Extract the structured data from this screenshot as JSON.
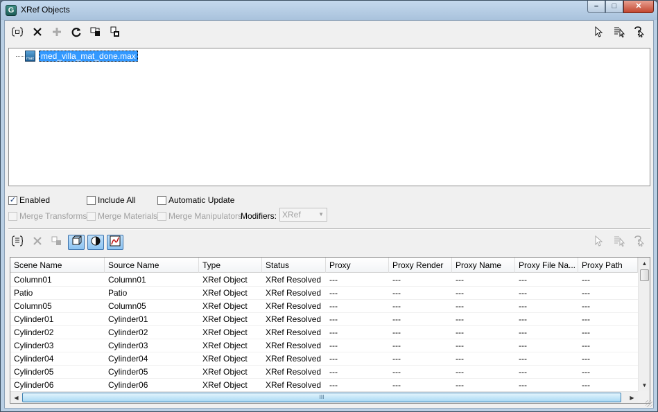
{
  "window": {
    "title": "XRef Objects",
    "app_icon_letter": "G"
  },
  "window_buttons": {
    "minimize": "–",
    "maximize": "□",
    "close": "✕"
  },
  "top_toolbar": {
    "left_icons": [
      "create-xref-icon",
      "remove-icon",
      "add-icon",
      "refresh-icon",
      "convert-selected-icon",
      "merge-icon"
    ],
    "right_icons": [
      "select-icon",
      "select-by-name-icon",
      "highlight-selected-icon"
    ]
  },
  "tree": {
    "file_name": "med_villa_mat_done.max",
    "file_icon_text": "max"
  },
  "options": {
    "enabled": {
      "label": "Enabled",
      "checked": true
    },
    "include_all": {
      "label": "Include All",
      "checked": false
    },
    "automatic_update": {
      "label": "Automatic Update",
      "checked": false
    },
    "merge_transforms": {
      "label": "Merge Transforms",
      "checked": false
    },
    "merge_materials": {
      "label": "Merge Materials",
      "checked": false
    },
    "merge_manipulators": {
      "label": "Merge Manipulators",
      "checked": false
    },
    "modifiers_label": "Modifiers:",
    "modifiers_value": "XRef"
  },
  "bottom_toolbar": {
    "left_icons": [
      "add-objects-icon",
      "remove-icon",
      "merge-in-scene-icon",
      "list-objects-icon",
      "list-materials-icon",
      "list-controllers-icon"
    ],
    "right_icons": [
      "select-icon",
      "select-by-name-icon",
      "highlight-selected-icon"
    ]
  },
  "table": {
    "columns": [
      "Scene Name",
      "Source Name",
      "Type",
      "Status",
      "Proxy",
      "Proxy Render",
      "Proxy Name",
      "Proxy File Na...",
      "Proxy Path"
    ],
    "rows": [
      [
        "Column01",
        "Column01",
        "XRef Object",
        "XRef Resolved",
        "---",
        "---",
        "---",
        "---",
        "---"
      ],
      [
        "Patio",
        "Patio",
        "XRef Object",
        "XRef Resolved",
        "---",
        "---",
        "---",
        "---",
        "---"
      ],
      [
        "Column05",
        "Column05",
        "XRef Object",
        "XRef Resolved",
        "---",
        "---",
        "---",
        "---",
        "---"
      ],
      [
        "Cylinder01",
        "Cylinder01",
        "XRef Object",
        "XRef Resolved",
        "---",
        "---",
        "---",
        "---",
        "---"
      ],
      [
        "Cylinder02",
        "Cylinder02",
        "XRef Object",
        "XRef Resolved",
        "---",
        "---",
        "---",
        "---",
        "---"
      ],
      [
        "Cylinder03",
        "Cylinder03",
        "XRef Object",
        "XRef Resolved",
        "---",
        "---",
        "---",
        "---",
        "---"
      ],
      [
        "Cylinder04",
        "Cylinder04",
        "XRef Object",
        "XRef Resolved",
        "---",
        "---",
        "---",
        "---",
        "---"
      ],
      [
        "Cylinder05",
        "Cylinder05",
        "XRef Object",
        "XRef Resolved",
        "---",
        "---",
        "---",
        "---",
        "---"
      ],
      [
        "Cylinder06",
        "Cylinder06",
        "XRef Object",
        "XRef Resolved",
        "---",
        "---",
        "---",
        "---",
        "---"
      ]
    ]
  },
  "scrollbars": {
    "hscroll_grip": "III"
  }
}
